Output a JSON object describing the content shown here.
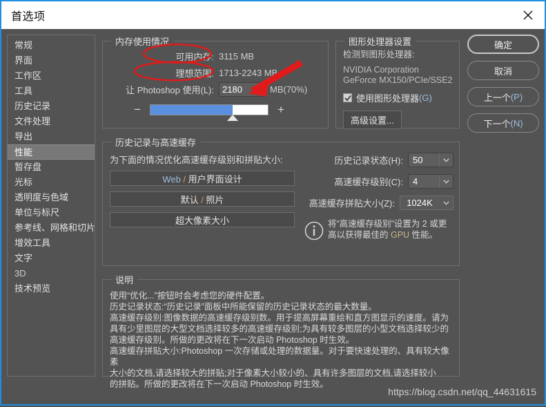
{
  "window": {
    "title": "首选项",
    "close_icon": "close-icon"
  },
  "sidebar": {
    "items": [
      {
        "label": "常规"
      },
      {
        "label": "界面"
      },
      {
        "label": "工作区"
      },
      {
        "label": "工具"
      },
      {
        "label": "历史记录"
      },
      {
        "label": "文件处理"
      },
      {
        "label": "导出"
      },
      {
        "label": "性能"
      },
      {
        "label": "暂存盘"
      },
      {
        "label": "光标"
      },
      {
        "label": "透明度与色域"
      },
      {
        "label": "单位与标尺"
      },
      {
        "label": "参考线、网格和切片"
      },
      {
        "label": "增效工具"
      },
      {
        "label": "文字"
      },
      {
        "label": "3D"
      },
      {
        "label": "技术预览"
      }
    ],
    "selected_index": 7
  },
  "memory": {
    "legend": "内存使用情况",
    "available_label": "可用内存:",
    "available_value": "3115 MB",
    "ideal_label": "理想范围:",
    "ideal_value": "1713-2243 MB",
    "let_ps_use_label": "让 Photoshop 使用(L):",
    "let_ps_use_value": "2180",
    "suffix": "MB(70%)",
    "slider_percent": 70,
    "minus_label": "−",
    "plus_label": "+"
  },
  "gpu": {
    "legend": "图形处理器设置",
    "detected_label": "检测到图形处理器:",
    "vendor": "NVIDIA Corporation",
    "model": "GeForce MX150/PCIe/SSE2",
    "use_gpu_label": "使用图形处理器",
    "use_gpu_key": "(G)",
    "use_gpu_checked": true,
    "advanced_button": "高级设置..."
  },
  "history_cache": {
    "legend": "历史记录与高速缓存",
    "caption": "为下面的情况优化高速缓存级别和拼贴大小:",
    "presets": [
      {
        "pre": "Web",
        "sep": " / ",
        "post": "用户界面设计"
      },
      {
        "pre": "默认",
        "sep": " / ",
        "post": "照片"
      },
      {
        "pre": "",
        "sep": "",
        "post": "超大像素大小"
      }
    ],
    "fields": [
      {
        "label": "历史记录状态(H):",
        "value": "50"
      },
      {
        "label": "高速缓存级别(C):",
        "value": "4"
      },
      {
        "label": "高速缓存拼贴大小(Z):",
        "value": "1024K"
      }
    ],
    "info_line1": "将“高速缓存级别”设置为 2 或更",
    "info_line2_a": "高以获得最佳的 ",
    "info_line2_gpu": "GPU",
    "info_line2_b": " 性能。"
  },
  "description": {
    "legend": "说明",
    "lines": [
      "使用“优化...”按钮时会考虑您的硬件配置。",
      "历史记录状态:“历史记录”面板中所能保留的历史记录状态的最大数量。",
      "高速缓存级别:图像数据的高速缓存级别数。用于提高屏幕重绘和直方图显示的速度。请为",
      "具有少里图层的大型文档选择较多的高速缓存级别;为具有较多图层的小型文档选择较少的",
      "高速缓存级别。所做的更改将在下一次启动 Photoshop 时生效。",
      "高速缓存拼贴大小:Photoshop 一次存储或处理的数据量。对于要快速处理的、具有较大像素",
      "大小的文档,请选择较大的拼贴;对于像素大小较小的、具有许多图层的文档,请选择较小",
      "的拼贴。所做的更改将在下一次启动 Photoshop 时生效。"
    ]
  },
  "buttons": [
    {
      "label": "确定",
      "key": "",
      "primary": true
    },
    {
      "label": "取消",
      "key": "",
      "primary": false
    },
    {
      "label": "上一个",
      "key": "(P)",
      "primary": false
    },
    {
      "label": "下一个",
      "key": "(N)",
      "primary": false
    }
  ],
  "annotations": {
    "color": "#e01b1b",
    "ellipse1_target": "可用内存:",
    "ellipse2_target": "理想范围:",
    "arrow_target": "2180"
  },
  "watermark": "https://blog.csdn.net/qq_44631615"
}
